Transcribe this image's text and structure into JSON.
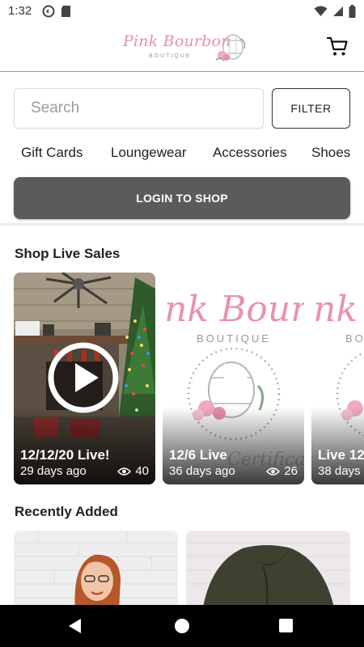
{
  "status_bar": {
    "time": "1:32",
    "left_icons": [
      "sync-icon",
      "sd-card-icon"
    ],
    "right_icons": [
      "wifi-icon",
      "signal-icon",
      "battery-icon"
    ]
  },
  "header": {
    "logo_text": "Pink Bourbon",
    "logo_subtext": "BOUTIQUE",
    "cart_icon": "cart-icon"
  },
  "search": {
    "placeholder": "Search",
    "value": "",
    "filter_label": "FILTER"
  },
  "categories": [
    "Gift Cards",
    "Loungewear",
    "Accessories",
    "Shoes"
  ],
  "login_label": "LOGIN TO SHOP",
  "live_sales": {
    "title": "Shop Live Sales",
    "items": [
      {
        "title": "12/12/20 Live!",
        "age": "29 days ago",
        "views": "40"
      },
      {
        "title": "12/6 Live",
        "age": "36 days ago",
        "views": "26"
      },
      {
        "title": "Live 12",
        "age": "38 days",
        "views": ""
      }
    ]
  },
  "recently_added": {
    "title": "Recently Added"
  },
  "colors": {
    "brand_pink": "#e68fb0",
    "login_button": "#5b5b5b",
    "nav_bar": "#000000"
  }
}
